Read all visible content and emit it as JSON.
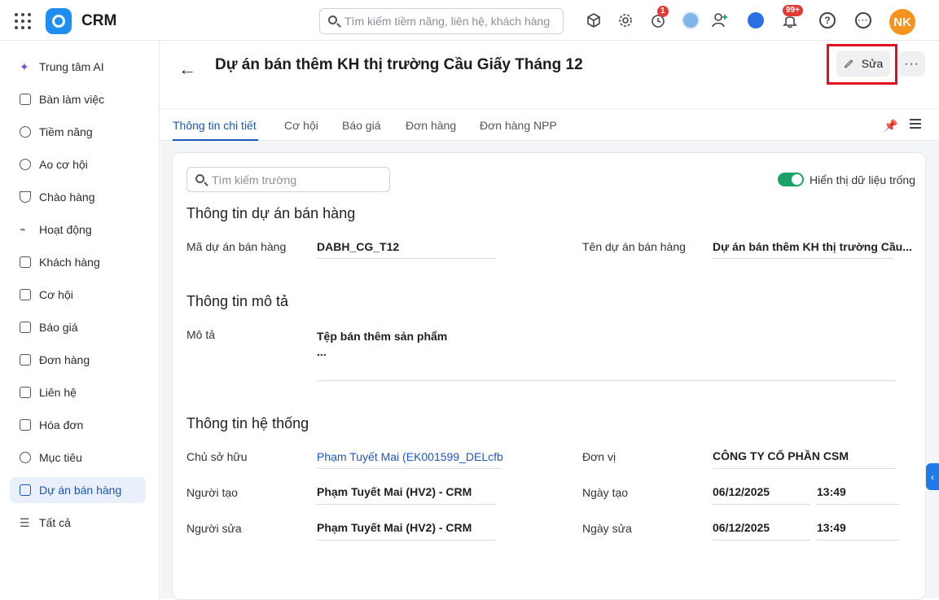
{
  "app": {
    "title": "CRM"
  },
  "topbar": {
    "search_placeholder": "Tìm kiếm tiềm năng, liên hệ, khách hàng",
    "timer_badge": "1",
    "notif_badge": "99+",
    "avatar_initials": "NK"
  },
  "sidebar": {
    "items": [
      {
        "label": "Trung tâm AI",
        "icon": "sparkle-icon"
      },
      {
        "label": "Bàn làm việc",
        "icon": "home-icon"
      },
      {
        "label": "Tiềm năng",
        "icon": "target-icon"
      },
      {
        "label": "Ao cơ hội",
        "icon": "pool-icon"
      },
      {
        "label": "Chào hàng",
        "icon": "magnet-icon"
      },
      {
        "label": "Hoạt động",
        "icon": "pulse-icon"
      },
      {
        "label": "Khách hàng",
        "icon": "building-icon"
      },
      {
        "label": "Cơ hội",
        "icon": "opportunity-icon"
      },
      {
        "label": "Báo giá",
        "icon": "quote-icon"
      },
      {
        "label": "Đơn hàng",
        "icon": "cart-icon"
      },
      {
        "label": "Liên hệ",
        "icon": "contact-icon"
      },
      {
        "label": "Hóa đơn",
        "icon": "invoice-icon"
      },
      {
        "label": "Mục tiêu",
        "icon": "goal-icon"
      },
      {
        "label": "Dự án bán hàng",
        "icon": "grid-icon"
      },
      {
        "label": "Tất cả",
        "icon": "menu-icon"
      }
    ],
    "active_index": 13
  },
  "header": {
    "title": "Dự án bán thêm KH thị trường Cầu Giấy Tháng 12",
    "edit_label": "Sửa",
    "more_label": "···"
  },
  "tabs": [
    "Thông tin chi tiết",
    "Cơ hội",
    "Báo giá",
    "Đơn hàng",
    "Đơn hàng NPP"
  ],
  "detail": {
    "search_placeholder": "Tìm kiếm trường",
    "toggle_label": "Hiển thị dữ liệu trống",
    "toggle_on": true,
    "sections": {
      "project": {
        "title": "Thông tin dự án bán hàng",
        "code_label": "Mã dự án bán hàng",
        "code_value": "DABH_CG_T12",
        "name_label": "Tên dự án bán hàng",
        "name_value": "Dự án bán thêm KH thị trường Cầu..."
      },
      "description": {
        "title": "Thông tin mô tả",
        "desc_label": "Mô tả",
        "desc_line1": "Tệp bán thêm sản phẩm",
        "desc_line2": "..."
      },
      "system": {
        "title": "Thông tin hệ thống",
        "owner_label": "Chủ sở hữu",
        "owner_value": "Phạm Tuyết Mai (EK001599_DELcfb",
        "unit_label": "Đơn vị",
        "unit_value": "CÔNG TY CỔ PHẦN CSM",
        "creator_label": "Người tạo",
        "creator_value": "Phạm Tuyết Mai (HV2) - CRM",
        "created_label": "Ngày tạo",
        "created_date": "06/12/2025",
        "created_time": "13:49",
        "editor_label": "Người sửa",
        "editor_value": "Phạm Tuyết Mai (HV2) - CRM",
        "edited_label": "Ngày sửa",
        "edited_date": "06/12/2025",
        "edited_time": "13:49"
      }
    }
  },
  "colors": {
    "accent": "#1a56b8",
    "link": "#1f55c9",
    "toggle": "#1aa16a",
    "avatar": "#f6931f",
    "highlight": "#e01020"
  }
}
